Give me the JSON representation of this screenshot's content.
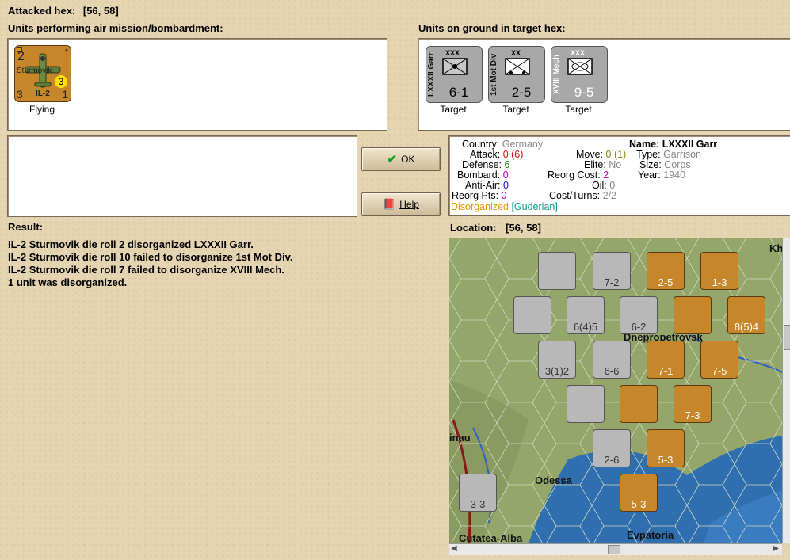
{
  "header": {
    "attacked_hex_label": "Attacked hex:",
    "attacked_hex_value": "[56, 58]"
  },
  "air_units": {
    "heading": "Units performing air mission/bombardment:",
    "items": [
      {
        "name": "Sturmovik",
        "model": "IL-2",
        "top_left": "2",
        "bottom_left": "3",
        "bottom_right": "1",
        "badge": "3",
        "caption": "Flying"
      }
    ]
  },
  "ground_units": {
    "heading": "Units on ground in target hex:",
    "items": [
      {
        "name": "LXXXII Garr",
        "size": "XXX",
        "value": "6-1",
        "caption": "Target"
      },
      {
        "name": "1st Mot Div",
        "size": "XX",
        "value": "2-5",
        "caption": "Target"
      },
      {
        "name": "XVIII Mech",
        "size": "XXX",
        "value": "9-5",
        "caption": "Target"
      }
    ]
  },
  "buttons": {
    "ok": "OK",
    "help": "Help"
  },
  "unit_info": {
    "country_k": "Country:",
    "country_v": "Germany",
    "attack_k": "Attack:",
    "attack_v": "0",
    "attack_v2": "(6)",
    "defense_k": "Defense:",
    "defense_v": "6",
    "bombard_k": "Bombard:",
    "bombard_v": "0",
    "antiair_k": "Anti-Air:",
    "antiair_v": "0",
    "reorgpts_k": "Reorg Pts:",
    "reorgpts_v": "0",
    "status": "Disorganized",
    "leader": "[Guderian]",
    "move_k": "Move:",
    "move_v": "0",
    "move_v2": "(1)",
    "elite_k": "Elite:",
    "elite_v": "No",
    "reorgcost_k": "Reorg Cost:",
    "reorgcost_v": "2",
    "oil_k": "Oil:",
    "oil_v": "0",
    "costturns_k": "Cost/Turns:",
    "costturns_v": "2/2",
    "name_k": "Name:",
    "name_v": "LXXXII Garr",
    "type_k": "Type:",
    "type_v": "Garrison",
    "size_k": "Size:",
    "size_v": "Corps",
    "year_k": "Year:",
    "year_v": "1940"
  },
  "result": {
    "heading": "Result:",
    "lines": [
      "IL-2 Sturmovik die roll 2 disorganized LXXXII Garr.",
      "IL-2 Sturmovik die roll 10 failed to disorganize 1st Mot Div.",
      "IL-2 Sturmovik die roll 7 failed to disorganize XVIII Mech.",
      "1 unit was disorganized."
    ]
  },
  "location": {
    "label": "Location:",
    "value": "[56, 58]"
  },
  "map": {
    "places": [
      "Dnepropetrovsk",
      "Odessa",
      "Cutatea-Alba",
      "Evpatoria",
      "inau",
      "Kh"
    ],
    "counters": [
      {
        "value": "",
        "color": "grey"
      },
      {
        "value": "7-2",
        "color": "grey"
      },
      {
        "value": "2-5",
        "color": "brown"
      },
      {
        "value": "1-3",
        "color": "brown"
      },
      {
        "value": "",
        "color": "grey"
      },
      {
        "value": "6(4)5",
        "color": "grey"
      },
      {
        "value": "6-2",
        "color": "grey"
      },
      {
        "value": "",
        "color": "brown"
      },
      {
        "value": "8(5)4",
        "color": "brown"
      },
      {
        "value": "3(1)2",
        "color": "grey"
      },
      {
        "value": "6-6",
        "color": "grey"
      },
      {
        "value": "7-1",
        "color": "brown"
      },
      {
        "value": "7-5",
        "color": "brown"
      },
      {
        "value": "",
        "color": "grey"
      },
      {
        "value": "",
        "color": "brown"
      },
      {
        "value": "7-3",
        "color": "brown"
      },
      {
        "value": "2-6",
        "color": "grey"
      },
      {
        "value": "5-3",
        "color": "brown"
      },
      {
        "value": "3-3",
        "color": "grey"
      },
      {
        "value": "5-3",
        "color": "brown"
      }
    ]
  },
  "colors": {
    "background": "#e6d5b3",
    "soviet": "#c8862a",
    "german": "#b8b8b8",
    "green_text": "#0e8a0e",
    "red_text": "#d01010"
  }
}
